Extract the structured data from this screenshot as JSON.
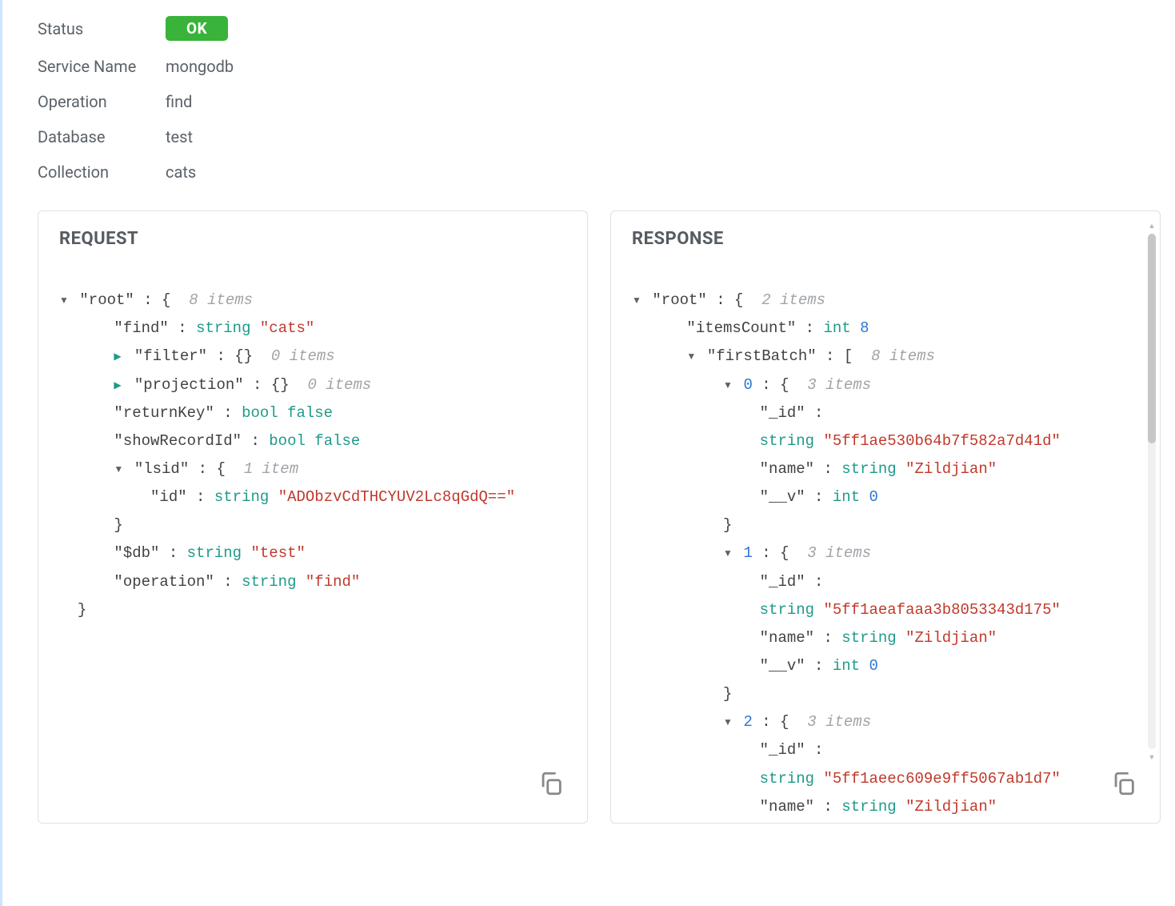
{
  "meta": {
    "status_label": "Status",
    "status_value": "OK",
    "service_name_label": "Service Name",
    "service_name_value": "mongodb",
    "operation_label": "Operation",
    "operation_value": "find",
    "database_label": "Database",
    "database_value": "test",
    "collection_label": "Collection",
    "collection_value": "cats"
  },
  "panels": {
    "request_title": "REQUEST",
    "response_title": "RESPONSE"
  },
  "tokens": {
    "root": "\"root\"",
    "colon": " : ",
    "obrace": "{",
    "cbrace": "}",
    "obracket": "[",
    "items8": "8 items",
    "items2": "2 items",
    "items3": "3 items",
    "items0": "0 items",
    "item1": "1 item",
    "string": "string",
    "bool": "bool",
    "int": "int"
  },
  "request": {
    "find_key": "\"find\"",
    "find_val": "\"cats\"",
    "filter_key": "\"filter\"",
    "filter_val": "{}",
    "projection_key": "\"projection\"",
    "projection_val": "{}",
    "returnKey_key": "\"returnKey\"",
    "returnKey_val": "false",
    "showRecordId_key": "\"showRecordId\"",
    "showRecordId_val": "false",
    "lsid_key": "\"lsid\"",
    "id_key": "\"id\"",
    "id_val": "\"ADObzvCdTHCYUV2Lc8qGdQ==\"",
    "db_key": "\"$db\"",
    "db_val": "\"test\"",
    "operation_key": "\"operation\"",
    "operation_val": "\"find\""
  },
  "response": {
    "itemsCount_key": "\"itemsCount\"",
    "itemsCount_val": "8",
    "firstBatch_key": "\"firstBatch\"",
    "idx0": "0",
    "idx1": "1",
    "idx2": "2",
    "id_key": "\"_id\"",
    "name_key": "\"name\"",
    "name_val": "\"Zildjian\"",
    "v_key": "\"__v\"",
    "v_val": "0",
    "id0_val": "\"5ff1ae530b64b7f582a7d41d\"",
    "id1_val": "\"5ff1aeafaaa3b8053343d175\"",
    "id2_val": "\"5ff1aeec609e9ff5067ab1d7\""
  }
}
